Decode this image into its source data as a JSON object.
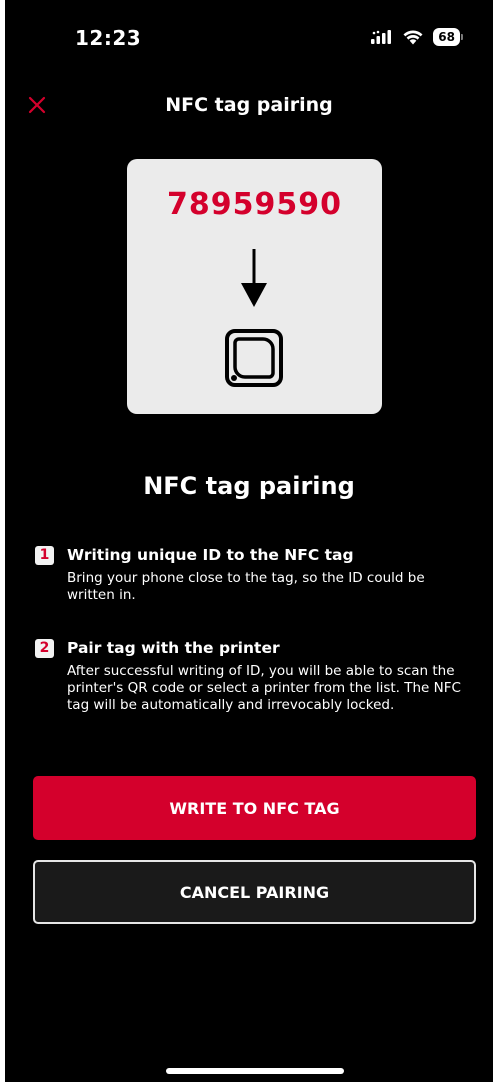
{
  "status_bar": {
    "time": "12:23",
    "battery": "68"
  },
  "header": {
    "title": "NFC tag pairing",
    "close_icon": "close-icon"
  },
  "illustration": {
    "tag_id": "78959590",
    "arrow_icon": "arrow-down-icon",
    "nfc_icon": "nfc-tag-icon"
  },
  "section": {
    "title": "NFC tag pairing"
  },
  "steps": [
    {
      "number": "1",
      "title": "Writing unique ID to the NFC tag",
      "description": "Bring your phone close to the tag, so the ID could be written in."
    },
    {
      "number": "2",
      "title": "Pair tag with the printer",
      "description": "After successful writing of ID, you will be able to scan the printer's QR code or select a printer from the list. The NFC tag will be automatically and irrevocably locked."
    }
  ],
  "buttons": {
    "write_label": "WRITE TO NFC TAG",
    "cancel_label": "CANCEL PAIRING"
  },
  "colors": {
    "accent": "#d4002c",
    "background": "#000000",
    "card": "#ebebeb"
  }
}
